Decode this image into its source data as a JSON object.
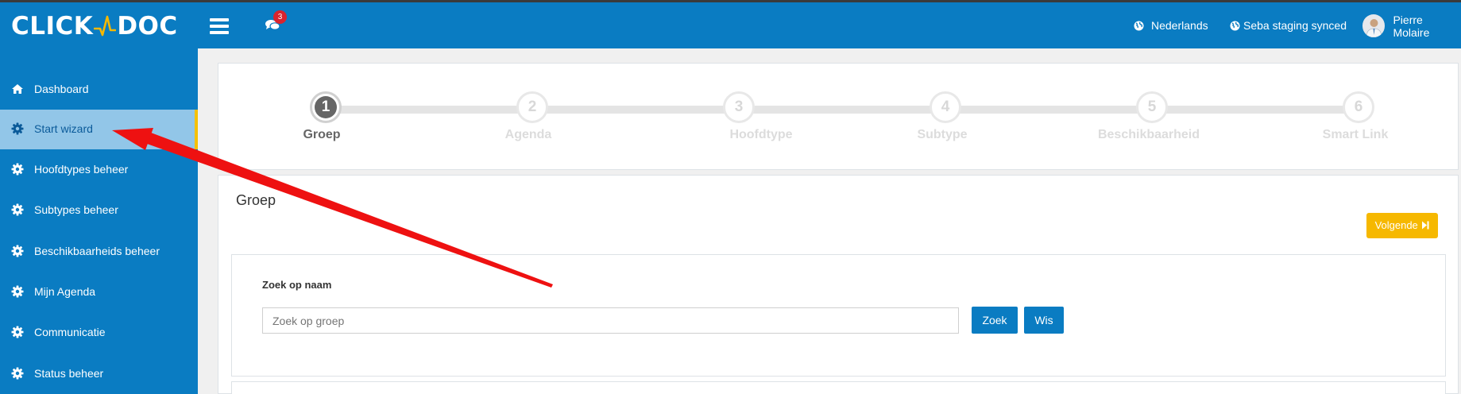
{
  "app": {
    "logo_left": "CLICK",
    "logo_right": "DOC",
    "brand_color": "#0a7cc2"
  },
  "header": {
    "chat_badge": "3",
    "language": "Nederlands",
    "sync_status": "Seba staging synced",
    "user_name": "Pierre Molaire"
  },
  "sidebar": {
    "items": [
      {
        "label": "Dashboard",
        "icon": "home-icon"
      },
      {
        "label": "Start wizard",
        "icon": "gear-icon",
        "active": true
      },
      {
        "label": "Hoofdtypes beheer",
        "icon": "gear-icon"
      },
      {
        "label": "Subtypes beheer",
        "icon": "gear-icon"
      },
      {
        "label": "Beschikbaarheids beheer",
        "icon": "gear-icon"
      },
      {
        "label": "Mijn Agenda",
        "icon": "gear-icon"
      },
      {
        "label": "Communicatie",
        "icon": "gear-icon"
      },
      {
        "label": "Status beheer",
        "icon": "gear-icon"
      }
    ]
  },
  "wizard": {
    "steps": [
      {
        "number": "1",
        "label": "Groep",
        "active": true
      },
      {
        "number": "2",
        "label": "Agenda"
      },
      {
        "number": "3",
        "label": "Hoofdtype"
      },
      {
        "number": "4",
        "label": "Subtype"
      },
      {
        "number": "5",
        "label": "Beschikbaarheid"
      },
      {
        "number": "6",
        "label": "Smart Link"
      }
    ]
  },
  "main": {
    "section_title": "Groep",
    "next_button": "Volgende",
    "search_label": "Zoek op naam",
    "search_placeholder": "Zoek op groep",
    "search_button": "Zoek",
    "clear_button": "Wis"
  },
  "annotation": {
    "arrow_color": "#ee1111"
  }
}
